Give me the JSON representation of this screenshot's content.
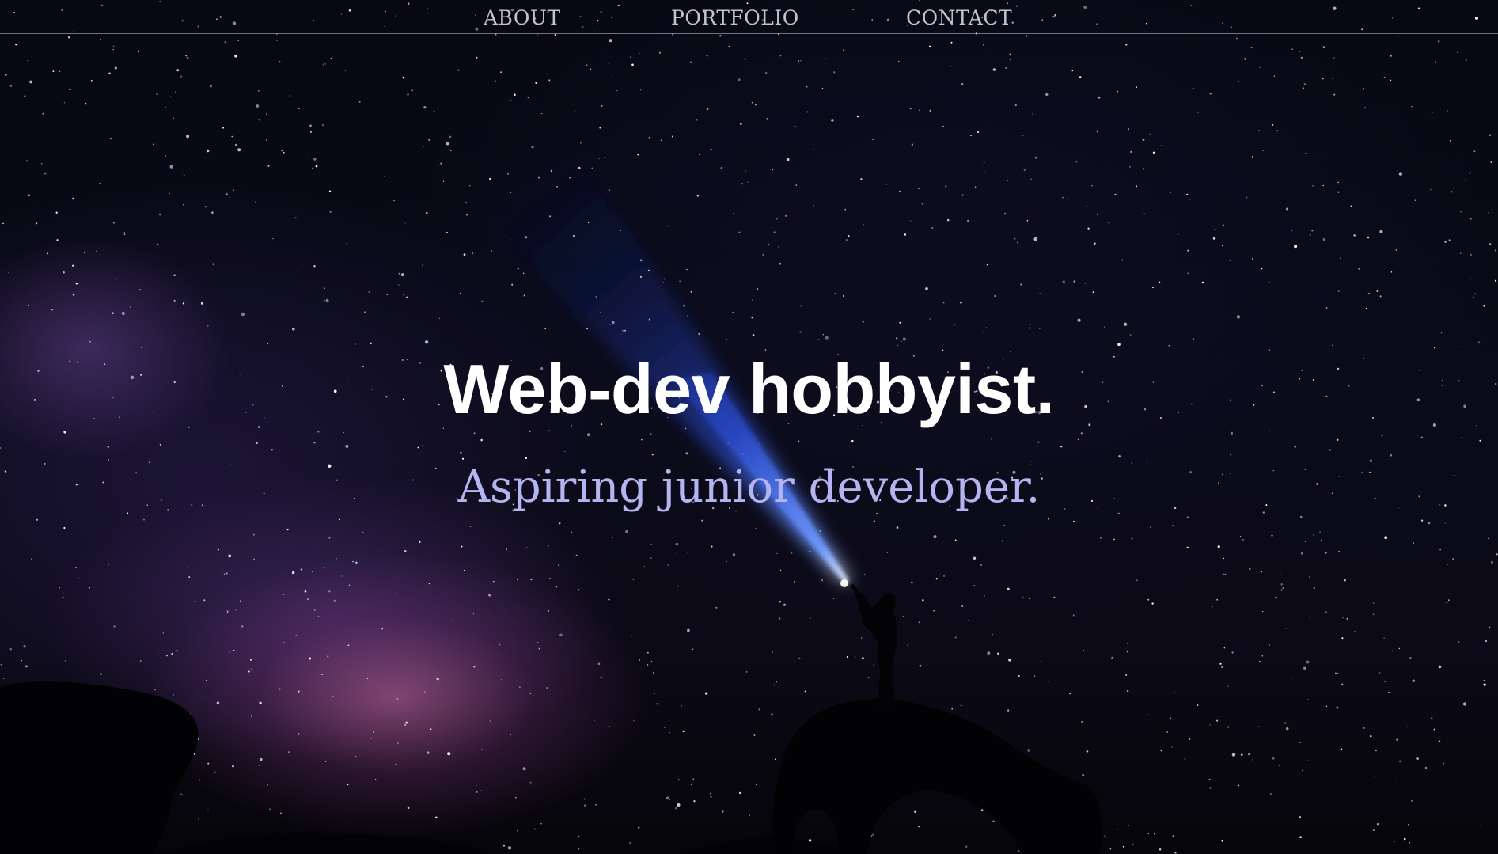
{
  "nav": {
    "links": [
      {
        "label": "ABOUT"
      },
      {
        "label": "PORTFOLIO"
      },
      {
        "label": "CONTACT"
      }
    ]
  },
  "hero": {
    "title": "Web-dev hobbyist.",
    "subtitle": "Aspiring junior developer."
  },
  "colors": {
    "nav_text": "#c4c4c8",
    "title_text": "#ffffff",
    "subtitle_text": "#b3b4f0",
    "beam": "#3f6bff",
    "sky": "#070812"
  },
  "background": {
    "description_icon": "night-sky-milky-way-flashlight-image"
  }
}
